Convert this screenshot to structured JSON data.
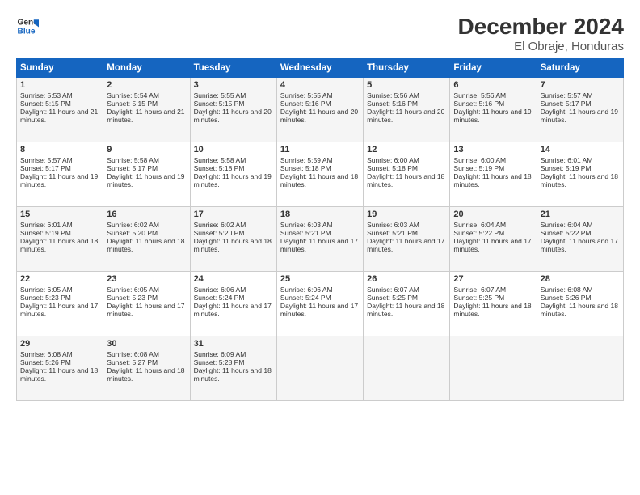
{
  "logo": {
    "line1": "General",
    "line2": "Blue"
  },
  "title": "December 2024",
  "subtitle": "El Obraje, Honduras",
  "days_of_week": [
    "Sunday",
    "Monday",
    "Tuesday",
    "Wednesday",
    "Thursday",
    "Friday",
    "Saturday"
  ],
  "weeks": [
    [
      {
        "day": "1",
        "rise": "Sunrise: 5:53 AM",
        "set": "Sunset: 5:15 PM",
        "daylight": "Daylight: 11 hours and 21 minutes."
      },
      {
        "day": "2",
        "rise": "Sunrise: 5:54 AM",
        "set": "Sunset: 5:15 PM",
        "daylight": "Daylight: 11 hours and 21 minutes."
      },
      {
        "day": "3",
        "rise": "Sunrise: 5:55 AM",
        "set": "Sunset: 5:15 PM",
        "daylight": "Daylight: 11 hours and 20 minutes."
      },
      {
        "day": "4",
        "rise": "Sunrise: 5:55 AM",
        "set": "Sunset: 5:16 PM",
        "daylight": "Daylight: 11 hours and 20 minutes."
      },
      {
        "day": "5",
        "rise": "Sunrise: 5:56 AM",
        "set": "Sunset: 5:16 PM",
        "daylight": "Daylight: 11 hours and 20 minutes."
      },
      {
        "day": "6",
        "rise": "Sunrise: 5:56 AM",
        "set": "Sunset: 5:16 PM",
        "daylight": "Daylight: 11 hours and 19 minutes."
      },
      {
        "day": "7",
        "rise": "Sunrise: 5:57 AM",
        "set": "Sunset: 5:17 PM",
        "daylight": "Daylight: 11 hours and 19 minutes."
      }
    ],
    [
      {
        "day": "8",
        "rise": "Sunrise: 5:57 AM",
        "set": "Sunset: 5:17 PM",
        "daylight": "Daylight: 11 hours and 19 minutes."
      },
      {
        "day": "9",
        "rise": "Sunrise: 5:58 AM",
        "set": "Sunset: 5:17 PM",
        "daylight": "Daylight: 11 hours and 19 minutes."
      },
      {
        "day": "10",
        "rise": "Sunrise: 5:58 AM",
        "set": "Sunset: 5:18 PM",
        "daylight": "Daylight: 11 hours and 19 minutes."
      },
      {
        "day": "11",
        "rise": "Sunrise: 5:59 AM",
        "set": "Sunset: 5:18 PM",
        "daylight": "Daylight: 11 hours and 18 minutes."
      },
      {
        "day": "12",
        "rise": "Sunrise: 6:00 AM",
        "set": "Sunset: 5:18 PM",
        "daylight": "Daylight: 11 hours and 18 minutes."
      },
      {
        "day": "13",
        "rise": "Sunrise: 6:00 AM",
        "set": "Sunset: 5:19 PM",
        "daylight": "Daylight: 11 hours and 18 minutes."
      },
      {
        "day": "14",
        "rise": "Sunrise: 6:01 AM",
        "set": "Sunset: 5:19 PM",
        "daylight": "Daylight: 11 hours and 18 minutes."
      }
    ],
    [
      {
        "day": "15",
        "rise": "Sunrise: 6:01 AM",
        "set": "Sunset: 5:19 PM",
        "daylight": "Daylight: 11 hours and 18 minutes."
      },
      {
        "day": "16",
        "rise": "Sunrise: 6:02 AM",
        "set": "Sunset: 5:20 PM",
        "daylight": "Daylight: 11 hours and 18 minutes."
      },
      {
        "day": "17",
        "rise": "Sunrise: 6:02 AM",
        "set": "Sunset: 5:20 PM",
        "daylight": "Daylight: 11 hours and 18 minutes."
      },
      {
        "day": "18",
        "rise": "Sunrise: 6:03 AM",
        "set": "Sunset: 5:21 PM",
        "daylight": "Daylight: 11 hours and 17 minutes."
      },
      {
        "day": "19",
        "rise": "Sunrise: 6:03 AM",
        "set": "Sunset: 5:21 PM",
        "daylight": "Daylight: 11 hours and 17 minutes."
      },
      {
        "day": "20",
        "rise": "Sunrise: 6:04 AM",
        "set": "Sunset: 5:22 PM",
        "daylight": "Daylight: 11 hours and 17 minutes."
      },
      {
        "day": "21",
        "rise": "Sunrise: 6:04 AM",
        "set": "Sunset: 5:22 PM",
        "daylight": "Daylight: 11 hours and 17 minutes."
      }
    ],
    [
      {
        "day": "22",
        "rise": "Sunrise: 6:05 AM",
        "set": "Sunset: 5:23 PM",
        "daylight": "Daylight: 11 hours and 17 minutes."
      },
      {
        "day": "23",
        "rise": "Sunrise: 6:05 AM",
        "set": "Sunset: 5:23 PM",
        "daylight": "Daylight: 11 hours and 17 minutes."
      },
      {
        "day": "24",
        "rise": "Sunrise: 6:06 AM",
        "set": "Sunset: 5:24 PM",
        "daylight": "Daylight: 11 hours and 17 minutes."
      },
      {
        "day": "25",
        "rise": "Sunrise: 6:06 AM",
        "set": "Sunset: 5:24 PM",
        "daylight": "Daylight: 11 hours and 17 minutes."
      },
      {
        "day": "26",
        "rise": "Sunrise: 6:07 AM",
        "set": "Sunset: 5:25 PM",
        "daylight": "Daylight: 11 hours and 18 minutes."
      },
      {
        "day": "27",
        "rise": "Sunrise: 6:07 AM",
        "set": "Sunset: 5:25 PM",
        "daylight": "Daylight: 11 hours and 18 minutes."
      },
      {
        "day": "28",
        "rise": "Sunrise: 6:08 AM",
        "set": "Sunset: 5:26 PM",
        "daylight": "Daylight: 11 hours and 18 minutes."
      }
    ],
    [
      {
        "day": "29",
        "rise": "Sunrise: 6:08 AM",
        "set": "Sunset: 5:26 PM",
        "daylight": "Daylight: 11 hours and 18 minutes."
      },
      {
        "day": "30",
        "rise": "Sunrise: 6:08 AM",
        "set": "Sunset: 5:27 PM",
        "daylight": "Daylight: 11 hours and 18 minutes."
      },
      {
        "day": "31",
        "rise": "Sunrise: 6:09 AM",
        "set": "Sunset: 5:28 PM",
        "daylight": "Daylight: 11 hours and 18 minutes."
      },
      null,
      null,
      null,
      null
    ]
  ]
}
